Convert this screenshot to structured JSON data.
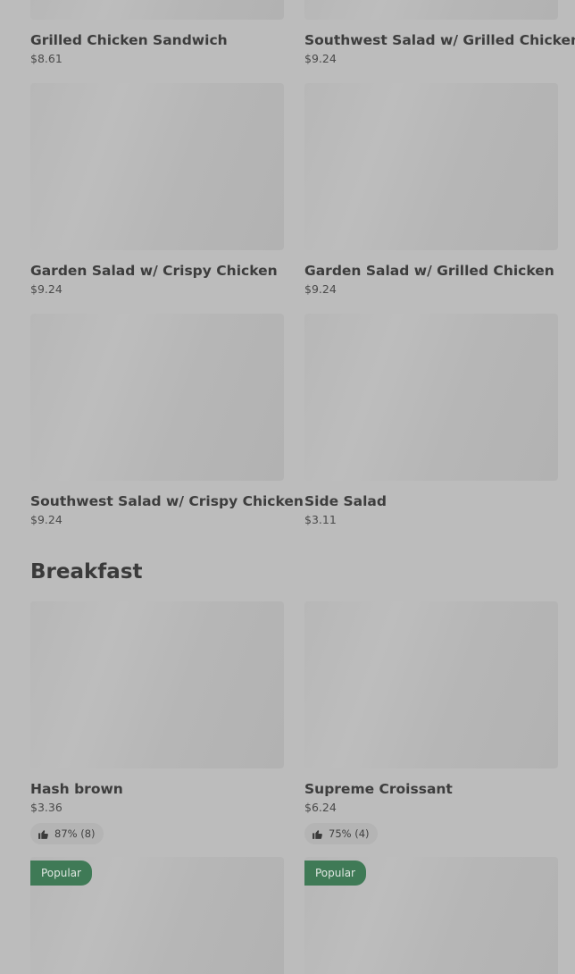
{
  "menu_items": [
    {
      "name": "Grilled Chicken Sandwich",
      "price": "$8.61"
    },
    {
      "name": "Southwest Salad w/ Grilled Chicken",
      "price": "$9.24"
    },
    {
      "name": "Garden Salad w/ Crispy Chicken",
      "price": "$9.24"
    },
    {
      "name": "Garden Salad w/ Grilled Chicken",
      "price": "$9.24"
    },
    {
      "name": "Southwest Salad w/ Crispy Chicken",
      "price": "$9.24"
    },
    {
      "name": "Side Salad",
      "price": "$3.11"
    }
  ],
  "breakfast": {
    "title": "Breakfast",
    "items": [
      {
        "name": "Hash brown",
        "price": "$3.36",
        "rating": "87% (8)"
      },
      {
        "name": "Supreme Croissant",
        "price": "$6.24",
        "rating": "75% (4)"
      },
      {
        "badge": "Popular"
      },
      {
        "badge": "Popular"
      }
    ]
  },
  "icons": {
    "rating": "thumbs-up-icon"
  },
  "colors": {
    "badge_bg": "#3f7a56",
    "background": "#bcbcbc"
  }
}
